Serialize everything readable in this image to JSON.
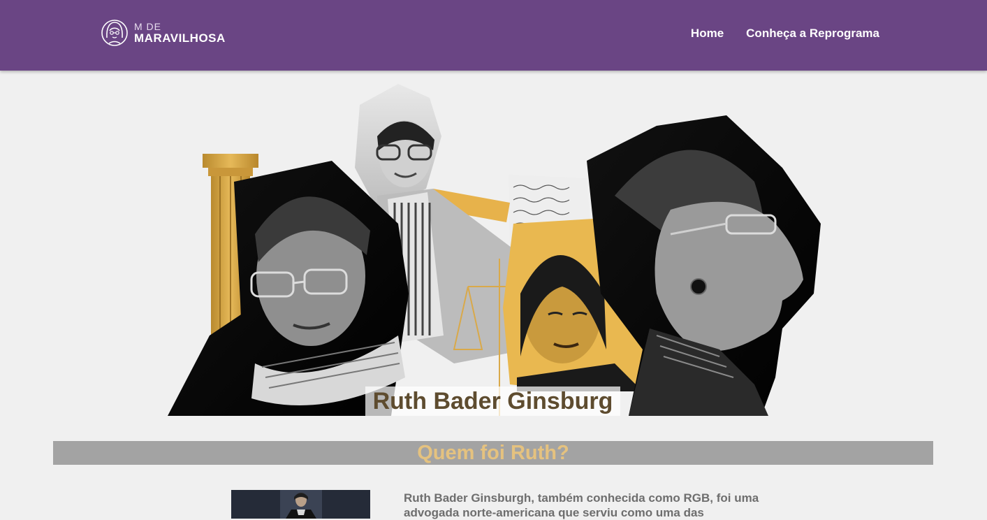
{
  "header": {
    "logo": {
      "line1": "M DE",
      "line2": "MARAVILHOSA",
      "icon": "woman-face-icon"
    },
    "nav": [
      {
        "label": "Home"
      },
      {
        "label": "Conheça a Reprograma"
      }
    ],
    "background_color": "#6a4584"
  },
  "hero": {
    "title": "Ruth Bader Ginsburg"
  },
  "section": {
    "title": "Quem foi Ruth?",
    "bar_color": "#a3a3a3",
    "title_color": "#e5c27f"
  },
  "bio": {
    "text": "Ruth Bader Ginsburgh, também conhecida como RGB, foi uma advogada norte-americana que serviu como uma das"
  }
}
